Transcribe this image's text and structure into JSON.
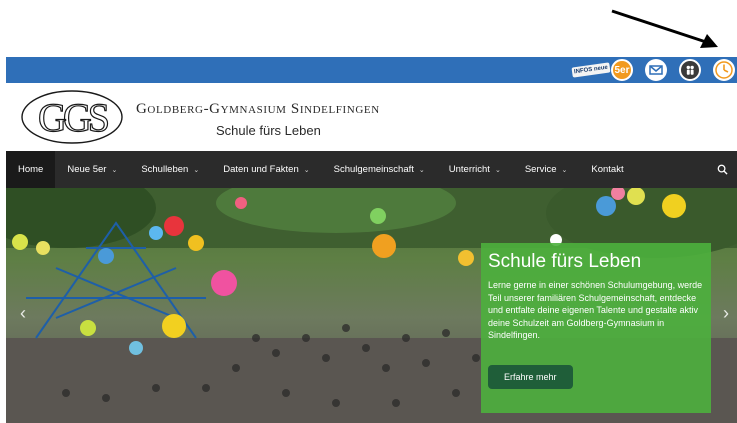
{
  "topbar": {
    "color": "#2f6fb8",
    "icons": [
      {
        "name": "infos-neu-icon",
        "tag": "INFOS neue",
        "badge": "5er"
      },
      {
        "name": "mail-icon"
      },
      {
        "name": "people-icon"
      },
      {
        "name": "clock-icon"
      }
    ]
  },
  "header": {
    "logo_text": "GGS",
    "school_name": "Goldberg-Gymnasium Sindelfingen",
    "tagline": "Schule fürs Leben"
  },
  "nav": {
    "items": [
      {
        "label": "Home",
        "dropdown": false,
        "active": true
      },
      {
        "label": "Neue 5er",
        "dropdown": true
      },
      {
        "label": "Schulleben",
        "dropdown": true
      },
      {
        "label": "Daten und Fakten",
        "dropdown": true
      },
      {
        "label": "Schulgemeinschaft",
        "dropdown": true
      },
      {
        "label": "Unterricht",
        "dropdown": true
      },
      {
        "label": "Service",
        "dropdown": true
      },
      {
        "label": "Kontakt",
        "dropdown": false
      }
    ],
    "chevron": "⌄",
    "search_icon": "search-icon"
  },
  "hero": {
    "title": "Schule fürs Leben",
    "text": "Lerne gerne in einer schönen Schulumgebung, werde Teil unserer familiären Schulgemeinschaft, entdecke und entfalte deine eigenen Talente und gestalte aktiv deine Schulzeit am Goldberg-Gymnasium in Sindelfingen.",
    "button_label": "Erfahre mehr",
    "prev_arrow": "‹",
    "next_arrow": "›"
  }
}
